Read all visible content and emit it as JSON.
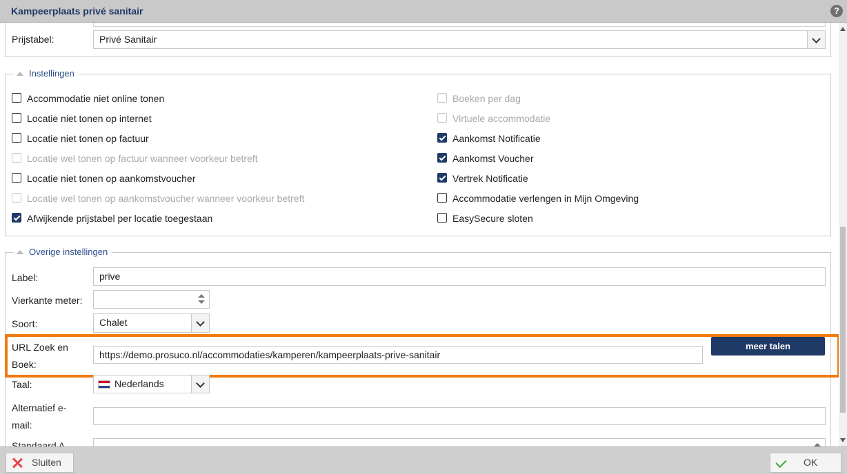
{
  "window": {
    "title": "Kampeerplaats privé sanitair",
    "help_icon": "?"
  },
  "top": {
    "prijstabel_label": "Prijstabel:",
    "prijstabel_value": "Privé Sanitair"
  },
  "instellingen": {
    "title": "Instellingen",
    "left": [
      {
        "label": "Accommodatie niet online tonen",
        "checked": false,
        "disabled": false
      },
      {
        "label": "Locatie niet tonen op internet",
        "checked": false,
        "disabled": false
      },
      {
        "label": "Locatie niet tonen op factuur",
        "checked": false,
        "disabled": false
      },
      {
        "label": "Locatie wel tonen op factuur wanneer voorkeur betreft",
        "checked": false,
        "disabled": true
      },
      {
        "label": "Locatie niet tonen op aankomstvoucher",
        "checked": false,
        "disabled": false
      },
      {
        "label": "Locatie wel tonen op aankomstvoucher wanneer voorkeur betreft",
        "checked": false,
        "disabled": true
      },
      {
        "label": "Afwijkende prijstabel per locatie toegestaan",
        "checked": true,
        "disabled": false
      }
    ],
    "right": [
      {
        "label": "Boeken per dag",
        "checked": false,
        "disabled": true
      },
      {
        "label": "Virtuele accommodatie",
        "checked": false,
        "disabled": true
      },
      {
        "label": "Aankomst Notificatie",
        "checked": true,
        "disabled": false
      },
      {
        "label": "Aankomst Voucher",
        "checked": true,
        "disabled": false
      },
      {
        "label": "Vertrek Notificatie",
        "checked": true,
        "disabled": false
      },
      {
        "label": "Accommodatie verlengen in Mijn Omgeving",
        "checked": false,
        "disabled": false
      },
      {
        "label": "EasySecure sloten",
        "checked": false,
        "disabled": false
      }
    ]
  },
  "overige": {
    "title": "Overige instellingen",
    "label_label": "Label:",
    "label_value": "prive",
    "vierkante_label": "Vierkante meter:",
    "vierkante_value": "",
    "soort_label": "Soort:",
    "soort_value": "Chalet",
    "url_label_line1": "URL Zoek en",
    "url_label_line2": "Boek:",
    "url_value": "https://demo.prosuco.nl/accommodaties/kamperen/kampeerplaats-prive-sanitair",
    "meer_talen": "meer talen",
    "taal_label": "Taal:",
    "taal_value": "Nederlands",
    "alt_email_line1": "Alternatief e-",
    "alt_email_line2": "mail:",
    "alt_email_value": "",
    "cut_label": "Standaard A..."
  },
  "footer": {
    "close_label": "Sluiten",
    "ok_label": "OK"
  },
  "colors": {
    "accent": "#1f3a66",
    "highlight": "#f07a10",
    "check_green": "#3aa236",
    "close_red": "#e04545"
  }
}
